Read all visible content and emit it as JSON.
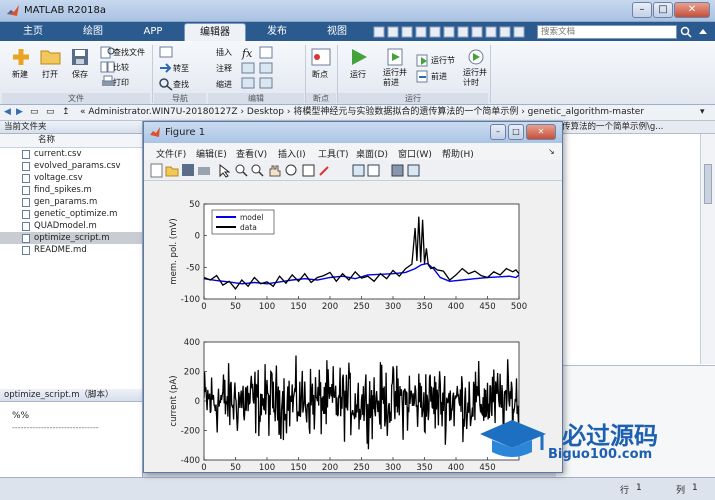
{
  "window": {
    "title": "MATLAB R2018a",
    "min": "–",
    "max": "□",
    "close": "✕"
  },
  "ribbon": {
    "tabs": [
      "主页",
      "绘图",
      "APP",
      "编辑器",
      "发布",
      "视图"
    ],
    "search_placeholder": "搜索文档",
    "file_group": {
      "new": "新建",
      "open": "打开",
      "save": "保存",
      "find_files": "查找文件",
      "compare": "比较",
      "print": "打印",
      "label": "文件"
    },
    "nav_group": {
      "insert": "插入",
      "comment": "注释",
      "indent": "缩进",
      "goto": "转至",
      "find": "查找",
      "label": "导航"
    },
    "edit_label": "编辑",
    "breakpoints_group": {
      "breakpoint": "断点",
      "label": "断点"
    },
    "run_group": {
      "run": "运行",
      "run_advance": "运行并\n前进",
      "run_section": "运行节",
      "advance": "前进",
      "run_time": "运行并\n计时",
      "label": "运行"
    }
  },
  "address": {
    "path": "« Administrator.WIN7U-20180127Z  ›  Desktop  ›  将模型神经元与实验数据拟合的遗传算法的一个简单示例  ›  genetic_algorithm-master"
  },
  "left_panel": {
    "title": "当前文件夹",
    "column": "名称",
    "files": [
      {
        "name": "current.csv",
        "selected": false
      },
      {
        "name": "evolved_params.csv",
        "selected": false
      },
      {
        "name": "voltage.csv",
        "selected": false
      },
      {
        "name": "find_spikes.m",
        "selected": false
      },
      {
        "name": "gen_params.m",
        "selected": false
      },
      {
        "name": "genetic_optimize.m",
        "selected": false
      },
      {
        "name": "QUADmodel.m",
        "selected": false
      },
      {
        "name": "optimize_script.m",
        "selected": true
      },
      {
        "name": "README.md",
        "selected": false
      }
    ],
    "details_title": "optimize_script.m（脚本）",
    "details_text": "%%",
    "details_dashes": "------------------------------"
  },
  "editor_tab_fragment": "传算法的一个简单示例\\g...",
  "status": {
    "row_label": "行",
    "row": "1",
    "col_label": "列",
    "col": "1"
  },
  "figure": {
    "title": "Figure 1",
    "menu": [
      "文件(F)",
      "编辑(E)",
      "查看(V)",
      "插入(I)",
      "工具(T)",
      "桌面(D)",
      "窗口(W)",
      "帮助(H)"
    ]
  },
  "watermark": {
    "cn": "必过源码",
    "url": "Biguo100.com"
  },
  "chart_data": [
    {
      "type": "line",
      "title": "",
      "xlabel": "",
      "ylabel": "mem. pol. (mV)",
      "xlim": [
        0,
        500
      ],
      "ylim": [
        -100,
        50
      ],
      "xticks": [
        0,
        50,
        100,
        150,
        200,
        250,
        300,
        350,
        400,
        450,
        500
      ],
      "yticks": [
        -100,
        -50,
        0,
        50
      ],
      "legend": {
        "position": "top-left",
        "entries": [
          "model",
          "data"
        ]
      },
      "series": [
        {
          "name": "model",
          "color": "#0000ee",
          "x": [
            0,
            20,
            40,
            60,
            80,
            100,
            120,
            140,
            160,
            180,
            200,
            220,
            240,
            260,
            280,
            300,
            320,
            335,
            345,
            355,
            365,
            375,
            390,
            410,
            430,
            450,
            470,
            485,
            495,
            500,
            505,
            510,
            515,
            517,
            520
          ],
          "y": [
            -68,
            -71,
            -73,
            -76,
            -74,
            -76,
            -73,
            -70,
            -68,
            -70,
            -66,
            -64,
            -68,
            -62,
            -61,
            -60,
            -58,
            -52,
            -46,
            -44,
            -53,
            -66,
            -72,
            -70,
            -68,
            -66,
            -65,
            -64,
            -66,
            -62,
            -58,
            -66,
            15,
            18,
            -63
          ]
        },
        {
          "name": "data",
          "color": "#000000",
          "x": [
            0,
            10,
            20,
            30,
            40,
            50,
            60,
            70,
            80,
            90,
            100,
            110,
            120,
            130,
            140,
            150,
            160,
            170,
            180,
            190,
            200,
            210,
            220,
            230,
            240,
            250,
            260,
            270,
            280,
            290,
            300,
            310,
            320,
            330,
            335,
            338,
            341,
            344,
            347,
            350,
            353,
            356,
            360,
            365,
            370,
            380,
            390,
            400,
            410,
            420,
            430,
            440,
            450,
            460,
            470,
            480,
            490,
            495,
            500,
            505,
            510,
            515,
            520
          ],
          "y": [
            -66,
            -70,
            -63,
            -78,
            -72,
            -84,
            -70,
            -80,
            -66,
            -76,
            -73,
            -80,
            -64,
            -75,
            -62,
            -72,
            -60,
            -74,
            -66,
            -63,
            -58,
            -72,
            -60,
            -70,
            -57,
            -67,
            -64,
            -72,
            -60,
            -68,
            -55,
            -64,
            -52,
            -45,
            12,
            -40,
            30,
            -42,
            25,
            -44,
            -20,
            -46,
            -52,
            -50,
            -54,
            -56,
            -70,
            -62,
            -52,
            -60,
            -56,
            -63,
            -66,
            -57,
            -62,
            -52,
            -57,
            -54,
            -60,
            -48,
            -56,
            -52,
            -62
          ]
        }
      ]
    },
    {
      "type": "line",
      "title": "",
      "xlabel": "time (msec)",
      "ylabel": "current (pA)",
      "xlim": [
        0,
        500
      ],
      "ylim": [
        -400,
        400
      ],
      "xticks": [
        0,
        50,
        100,
        150,
        200,
        250,
        300,
        350,
        400,
        450
      ],
      "yticks": [
        -400,
        -200,
        0,
        200,
        400
      ],
      "series": [
        {
          "name": "",
          "color": "#000000",
          "noise_amplitude": 200,
          "samples": 520
        }
      ]
    }
  ]
}
